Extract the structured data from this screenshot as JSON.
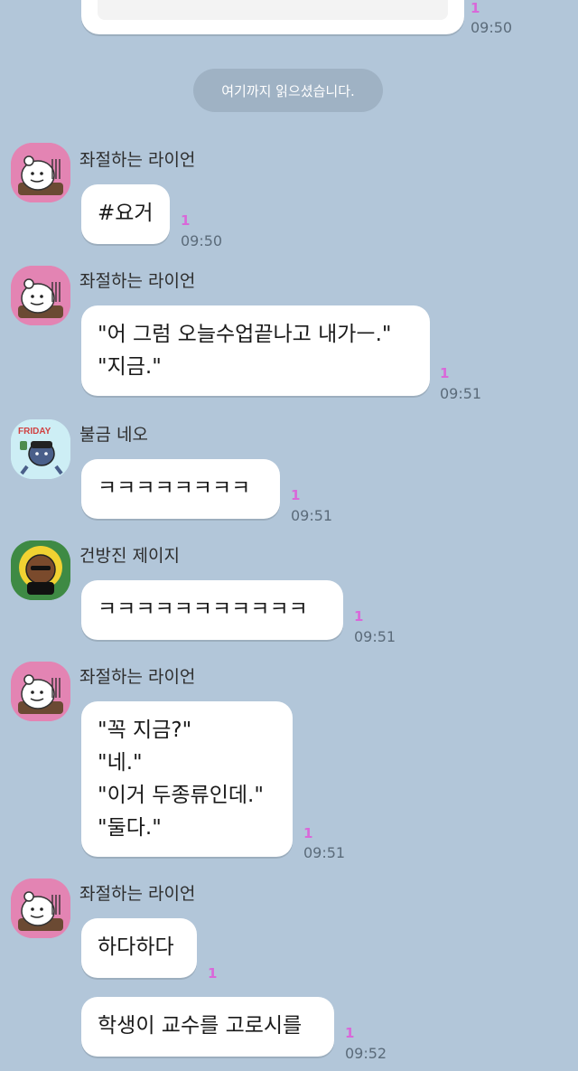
{
  "read_divider": "여기까지 읽으셨습니다.",
  "messages": [
    {
      "unread": "1",
      "time": "09:50"
    },
    {
      "sender": "좌절하는 라이언",
      "lines": [
        "#요거"
      ],
      "unread": "1",
      "time": "09:50"
    },
    {
      "sender": "좌절하는 라이언",
      "lines": [
        "\"어 그럼 오늘수업끝나고 내가ㅡ.\"",
        "\"지금.\""
      ],
      "unread": "1",
      "time": "09:51"
    },
    {
      "sender": "불금 네오",
      "lines": [
        "ㅋㅋㅋㅋㅋㅋㅋㅋ"
      ],
      "unread": "1",
      "time": "09:51"
    },
    {
      "sender": "건방진 제이지",
      "lines": [
        "ㅋㅋㅋㅋㅋㅋㅋㅋㅋㅋㅋ"
      ],
      "unread": "1",
      "time": "09:51"
    },
    {
      "sender": "좌절하는 라이언",
      "lines": [
        "\"꼭 지금?\"",
        "\"네.\"",
        "\"이거 두종류인데.\"",
        "\"둘다.\""
      ],
      "unread": "1",
      "time": "09:51"
    },
    {
      "sender": "좌절하는 라이언",
      "lines": [
        "하다하다"
      ],
      "unread": "1",
      "time": ""
    },
    {
      "lines": [
        "학생이 교수를 고로시를"
      ],
      "unread": "1",
      "time": "09:52"
    }
  ],
  "avatars": {
    "ryan": "ryan-frustrated-icon",
    "neo": "neo-friday-icon",
    "jayg": "jayg-cocky-icon"
  },
  "colors": {
    "background": "#b2c6d9",
    "unread": "#d968d9",
    "divider": "#9fb2c4"
  }
}
